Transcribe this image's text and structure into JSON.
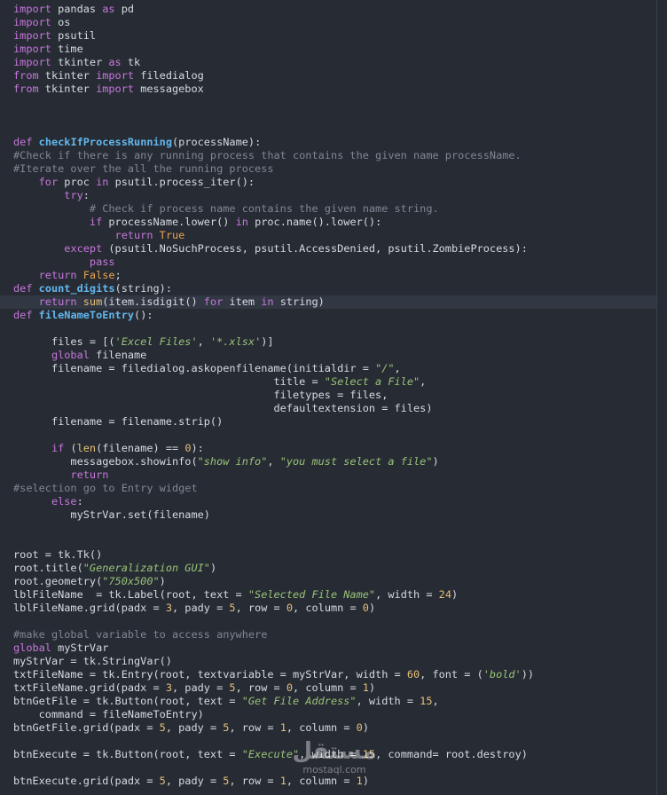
{
  "editor": {
    "active_line": 22,
    "colors": {
      "background": "#272b33",
      "keyword": "#c678dd",
      "function": "#62b8ef",
      "string": "#98c379",
      "number": "#e5c07b",
      "comment": "#7f8794",
      "text": "#d6dbe2"
    },
    "lines": [
      [
        [
          "kw",
          "import"
        ],
        [
          "t",
          " pandas "
        ],
        [
          "kw",
          "as"
        ],
        [
          "t",
          " pd"
        ]
      ],
      [
        [
          "kw",
          "import"
        ],
        [
          "t",
          " os"
        ]
      ],
      [
        [
          "kw",
          "import"
        ],
        [
          "t",
          " psutil"
        ]
      ],
      [
        [
          "kw",
          "import"
        ],
        [
          "t",
          " time"
        ]
      ],
      [
        [
          "kw",
          "import"
        ],
        [
          "t",
          " tkinter "
        ],
        [
          "kw",
          "as"
        ],
        [
          "t",
          " tk"
        ]
      ],
      [
        [
          "kw",
          "from"
        ],
        [
          "t",
          " tkinter "
        ],
        [
          "kw",
          "import"
        ],
        [
          "t",
          " filedialog"
        ]
      ],
      [
        [
          "kw",
          "from"
        ],
        [
          "t",
          " tkinter "
        ],
        [
          "kw",
          "import"
        ],
        [
          "t",
          " messagebox"
        ]
      ],
      [],
      [],
      [],
      [
        [
          "kw",
          "def"
        ],
        [
          "t",
          " "
        ],
        [
          "fn",
          "checkIfProcessRunning"
        ],
        [
          "t",
          "(processName):"
        ]
      ],
      [
        [
          "cm",
          "#Check if there is any running process that contains the given name processName."
        ]
      ],
      [
        [
          "cm",
          "#Iterate over the all the running process"
        ]
      ],
      [
        [
          "t",
          "    "
        ],
        [
          "kw",
          "for"
        ],
        [
          "t",
          " proc "
        ],
        [
          "kw",
          "in"
        ],
        [
          "t",
          " psutil.process_iter():"
        ]
      ],
      [
        [
          "t",
          "        "
        ],
        [
          "kw",
          "try"
        ],
        [
          "t",
          ":"
        ]
      ],
      [
        [
          "t",
          "            "
        ],
        [
          "cm",
          "# Check if process name contains the given name string."
        ]
      ],
      [
        [
          "t",
          "            "
        ],
        [
          "kw",
          "if"
        ],
        [
          "t",
          " processName.lower() "
        ],
        [
          "kw",
          "in"
        ],
        [
          "t",
          " proc.name().lower():"
        ]
      ],
      [
        [
          "t",
          "                "
        ],
        [
          "kw",
          "return"
        ],
        [
          "t",
          " "
        ],
        [
          "bool",
          "True"
        ]
      ],
      [
        [
          "t",
          "        "
        ],
        [
          "kw",
          "except"
        ],
        [
          "t",
          " (psutil.NoSuchProcess, psutil.AccessDenied, psutil.ZombieProcess):"
        ]
      ],
      [
        [
          "t",
          "            "
        ],
        [
          "kw",
          "pass"
        ]
      ],
      [
        [
          "t",
          "    "
        ],
        [
          "kw",
          "return"
        ],
        [
          "t",
          " "
        ],
        [
          "bool",
          "False"
        ],
        [
          "t",
          ";"
        ]
      ],
      [
        [
          "kw",
          "def"
        ],
        [
          "t",
          " "
        ],
        [
          "fn",
          "count_digits"
        ],
        [
          "t",
          "(string):"
        ]
      ],
      [
        [
          "t",
          "    "
        ],
        [
          "kw",
          "return"
        ],
        [
          "t",
          " "
        ],
        [
          "fcall",
          "sum"
        ],
        [
          "t",
          "(item.isdigit() "
        ],
        [
          "kw",
          "for"
        ],
        [
          "t",
          " item "
        ],
        [
          "kw",
          "in"
        ],
        [
          "t",
          " string)"
        ]
      ],
      [
        [
          "kw",
          "def"
        ],
        [
          "t",
          " "
        ],
        [
          "fn",
          "fileNameToEntry"
        ],
        [
          "t",
          "():"
        ]
      ],
      [],
      [
        [
          "t",
          "      files = [("
        ],
        [
          "str",
          "'Excel Files'"
        ],
        [
          "t",
          ", "
        ],
        [
          "str",
          "'*.xlsx'"
        ],
        [
          "t",
          ")]"
        ]
      ],
      [
        [
          "t",
          "      "
        ],
        [
          "kw",
          "global"
        ],
        [
          "t",
          " filename"
        ]
      ],
      [
        [
          "t",
          "      filename = filedialog.askopenfilename(initialdir = "
        ],
        [
          "str",
          "\"/\""
        ],
        [
          "t",
          ","
        ]
      ],
      [
        [
          "t",
          "                                         title = "
        ],
        [
          "str",
          "\"Select a File\""
        ],
        [
          "t",
          ","
        ]
      ],
      [
        [
          "t",
          "                                         filetypes = files,"
        ]
      ],
      [
        [
          "t",
          "                                         defaultextension = files)"
        ]
      ],
      [
        [
          "t",
          "      filename = filename.strip()"
        ]
      ],
      [],
      [
        [
          "t",
          "      "
        ],
        [
          "kw",
          "if"
        ],
        [
          "t",
          " ("
        ],
        [
          "fcall",
          "len"
        ],
        [
          "t",
          "(filename) == "
        ],
        [
          "num",
          "0"
        ],
        [
          "t",
          "):"
        ]
      ],
      [
        [
          "t",
          "         messagebox.showinfo("
        ],
        [
          "str",
          "\"show info\""
        ],
        [
          "t",
          ", "
        ],
        [
          "str",
          "\"you must select a file\""
        ],
        [
          "t",
          ")"
        ]
      ],
      [
        [
          "t",
          "         "
        ],
        [
          "kw",
          "return"
        ]
      ],
      [
        [
          "cm",
          "#selection go to Entry widget"
        ]
      ],
      [
        [
          "t",
          "      "
        ],
        [
          "kw",
          "else"
        ],
        [
          "t",
          ":"
        ]
      ],
      [
        [
          "t",
          "         myStrVar.set(filename)"
        ]
      ],
      [],
      [],
      [
        [
          "t",
          "root = tk.Tk()"
        ]
      ],
      [
        [
          "t",
          "root.title("
        ],
        [
          "str",
          "\"Generalization GUI\""
        ],
        [
          "t",
          ")"
        ]
      ],
      [
        [
          "t",
          "root.geometry("
        ],
        [
          "str",
          "\"750x500\""
        ],
        [
          "t",
          ")"
        ]
      ],
      [
        [
          "t",
          "lblFileName  = tk.Label(root, text = "
        ],
        [
          "str",
          "\"Selected File Name\""
        ],
        [
          "t",
          ", width = "
        ],
        [
          "num",
          "24"
        ],
        [
          "t",
          ")"
        ]
      ],
      [
        [
          "t",
          "lblFileName.grid(padx = "
        ],
        [
          "num",
          "3"
        ],
        [
          "t",
          ", pady = "
        ],
        [
          "num",
          "5"
        ],
        [
          "t",
          ", row = "
        ],
        [
          "num",
          "0"
        ],
        [
          "t",
          ", column = "
        ],
        [
          "num",
          "0"
        ],
        [
          "t",
          ")"
        ]
      ],
      [],
      [
        [
          "cm",
          "#make global variable to access anywhere"
        ]
      ],
      [
        [
          "kw",
          "global"
        ],
        [
          "t",
          " myStrVar"
        ]
      ],
      [
        [
          "t",
          "myStrVar = tk.StringVar()"
        ]
      ],
      [
        [
          "t",
          "txtFileName = tk.Entry(root, textvariable = myStrVar, width = "
        ],
        [
          "num",
          "60"
        ],
        [
          "t",
          ", font = ("
        ],
        [
          "str",
          "'bold'"
        ],
        [
          "t",
          "))"
        ]
      ],
      [
        [
          "t",
          "txtFileName.grid(padx = "
        ],
        [
          "num",
          "3"
        ],
        [
          "t",
          ", pady = "
        ],
        [
          "num",
          "5"
        ],
        [
          "t",
          ", row = "
        ],
        [
          "num",
          "0"
        ],
        [
          "t",
          ", column = "
        ],
        [
          "num",
          "1"
        ],
        [
          "t",
          ")"
        ]
      ],
      [
        [
          "t",
          "btnGetFile = tk.Button(root, text = "
        ],
        [
          "str",
          "\"Get File Address\""
        ],
        [
          "t",
          ", width = "
        ],
        [
          "num",
          "15"
        ],
        [
          "t",
          ","
        ]
      ],
      [
        [
          "t",
          "    command = fileNameToEntry)"
        ]
      ],
      [
        [
          "t",
          "btnGetFile.grid(padx = "
        ],
        [
          "num",
          "5"
        ],
        [
          "t",
          ", pady = "
        ],
        [
          "num",
          "5"
        ],
        [
          "t",
          ", row = "
        ],
        [
          "num",
          "1"
        ],
        [
          "t",
          ", column = "
        ],
        [
          "num",
          "0"
        ],
        [
          "t",
          ")"
        ]
      ],
      [],
      [
        [
          "t",
          "btnExecute = tk.Button(root, text = "
        ],
        [
          "str",
          "\"Execute\""
        ],
        [
          "t",
          ", width = "
        ],
        [
          "num",
          "15"
        ],
        [
          "t",
          ", command= root.destroy)"
        ]
      ],
      [],
      [
        [
          "t",
          "btnExecute.grid(padx = "
        ],
        [
          "num",
          "5"
        ],
        [
          "t",
          ", pady = "
        ],
        [
          "num",
          "5"
        ],
        [
          "t",
          ", row = "
        ],
        [
          "num",
          "1"
        ],
        [
          "t",
          ", column = "
        ],
        [
          "num",
          "1"
        ],
        [
          "t",
          ")"
        ]
      ]
    ]
  },
  "watermark": {
    "logo": "مستقل",
    "text": "mostaql.com"
  }
}
